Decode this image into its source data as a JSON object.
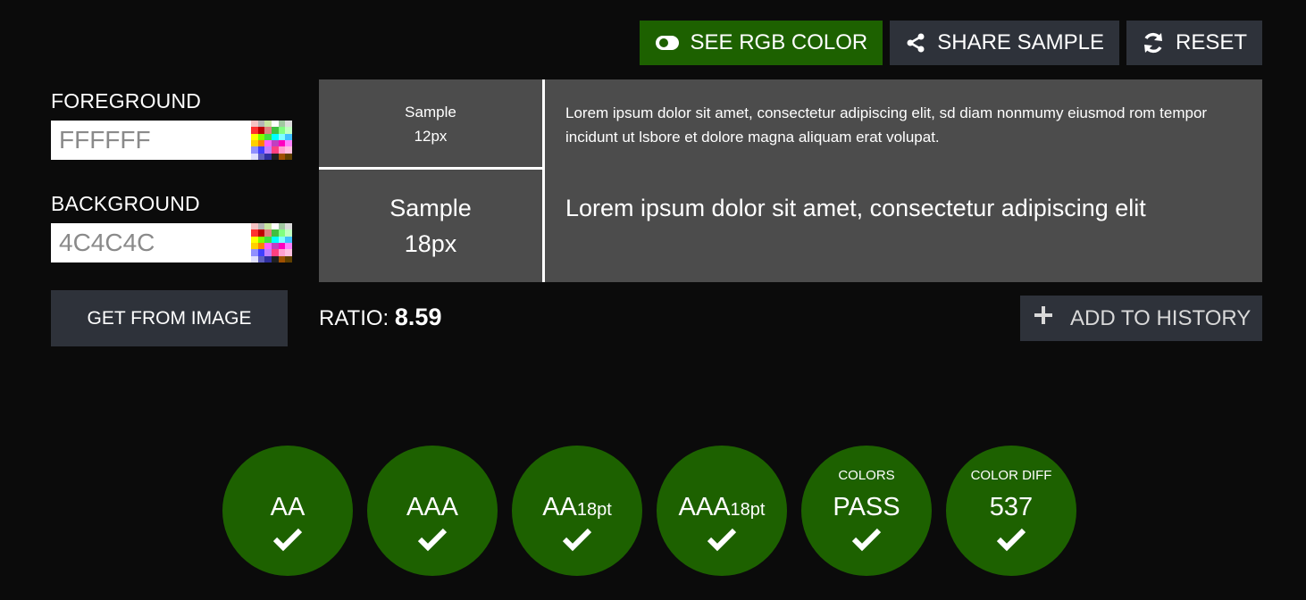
{
  "toolbar": {
    "rgb_label": "SEE RGB COLOR",
    "share_label": "SHARE SAMPLE",
    "reset_label": "RESET"
  },
  "foreground": {
    "label": "FOREGROUND",
    "value": "FFFFFF"
  },
  "background": {
    "label": "BACKGROUND",
    "value": "4C4C4C"
  },
  "get_from_image_label": "GET FROM IMAGE",
  "samples": {
    "small_label_1": "Sample",
    "small_label_2": "12px",
    "small_text": "Lorem ipsum dolor sit amet, consectetur adipiscing elit, sd diam nonmumy eiusmod rom tempor incidunt ut lsbore et dolore magna aliquam erat volupat.",
    "big_label_1": "Sample",
    "big_label_2": "18px",
    "big_text": "Lorem ipsum dolor sit amet, consectetur adipiscing elit"
  },
  "ratio": {
    "label": "RATIO:",
    "value": "8.59"
  },
  "add_to_history_label": "ADD TO HISTORY",
  "results": [
    {
      "top": "",
      "main": "AA",
      "sub": ""
    },
    {
      "top": "",
      "main": "AAA",
      "sub": ""
    },
    {
      "top": "",
      "main": "AA",
      "sub": "18pt"
    },
    {
      "top": "",
      "main": "AAA",
      "sub": "18pt"
    },
    {
      "top": "COLORS",
      "main": "PASS",
      "sub": ""
    },
    {
      "top": "COLOR DIFF",
      "main": "537",
      "sub": ""
    }
  ],
  "colors": {
    "page_bg": "#0b0b0b",
    "accent_green": "#1d6100",
    "button_dark": "#2e323a",
    "sample_bg": "#4c4c4c"
  },
  "icons": [
    "toggle-icon",
    "share-icon",
    "refresh-icon",
    "plus-icon",
    "check-icon",
    "palette-icon"
  ]
}
